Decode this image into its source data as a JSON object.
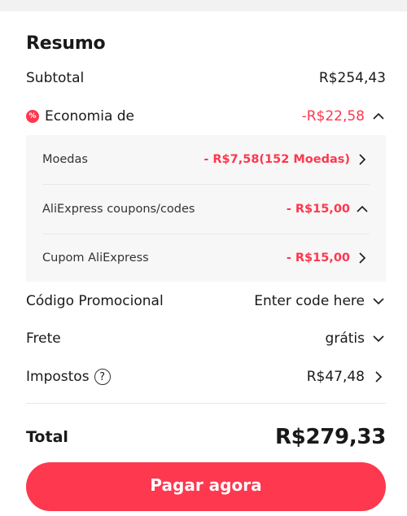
{
  "summary": {
    "title": "Resumo",
    "subtotal": {
      "label": "Subtotal",
      "value": "R$254,43"
    },
    "savings": {
      "label": "Economia de",
      "value": "-R$22,58",
      "items": [
        {
          "label": "Moedas",
          "value": "- R$7,58(152 Moedas)",
          "chevron": "chevron-right-icon"
        },
        {
          "label": "AliExpress coupons/codes",
          "value": "- R$15,00",
          "chevron": "chevron-up-icon"
        },
        {
          "label": "Cupom AliExpress",
          "value": "- R$15,00",
          "chevron": "chevron-right-icon"
        }
      ]
    },
    "promo": {
      "label": "Código Promocional",
      "value": "Enter code here"
    },
    "shipping": {
      "label": "Frete",
      "value": "grátis"
    },
    "taxes": {
      "label": "Impostos",
      "help": "?",
      "value": "R$47,48"
    },
    "total": {
      "label": "Total",
      "value": "R$279,33"
    },
    "pay_button": "Pagar agora"
  },
  "colors": {
    "accent": "#fd384f",
    "background": "#f2f2f2",
    "card": "#ffffff",
    "subpanel": "#f7f7f7"
  }
}
